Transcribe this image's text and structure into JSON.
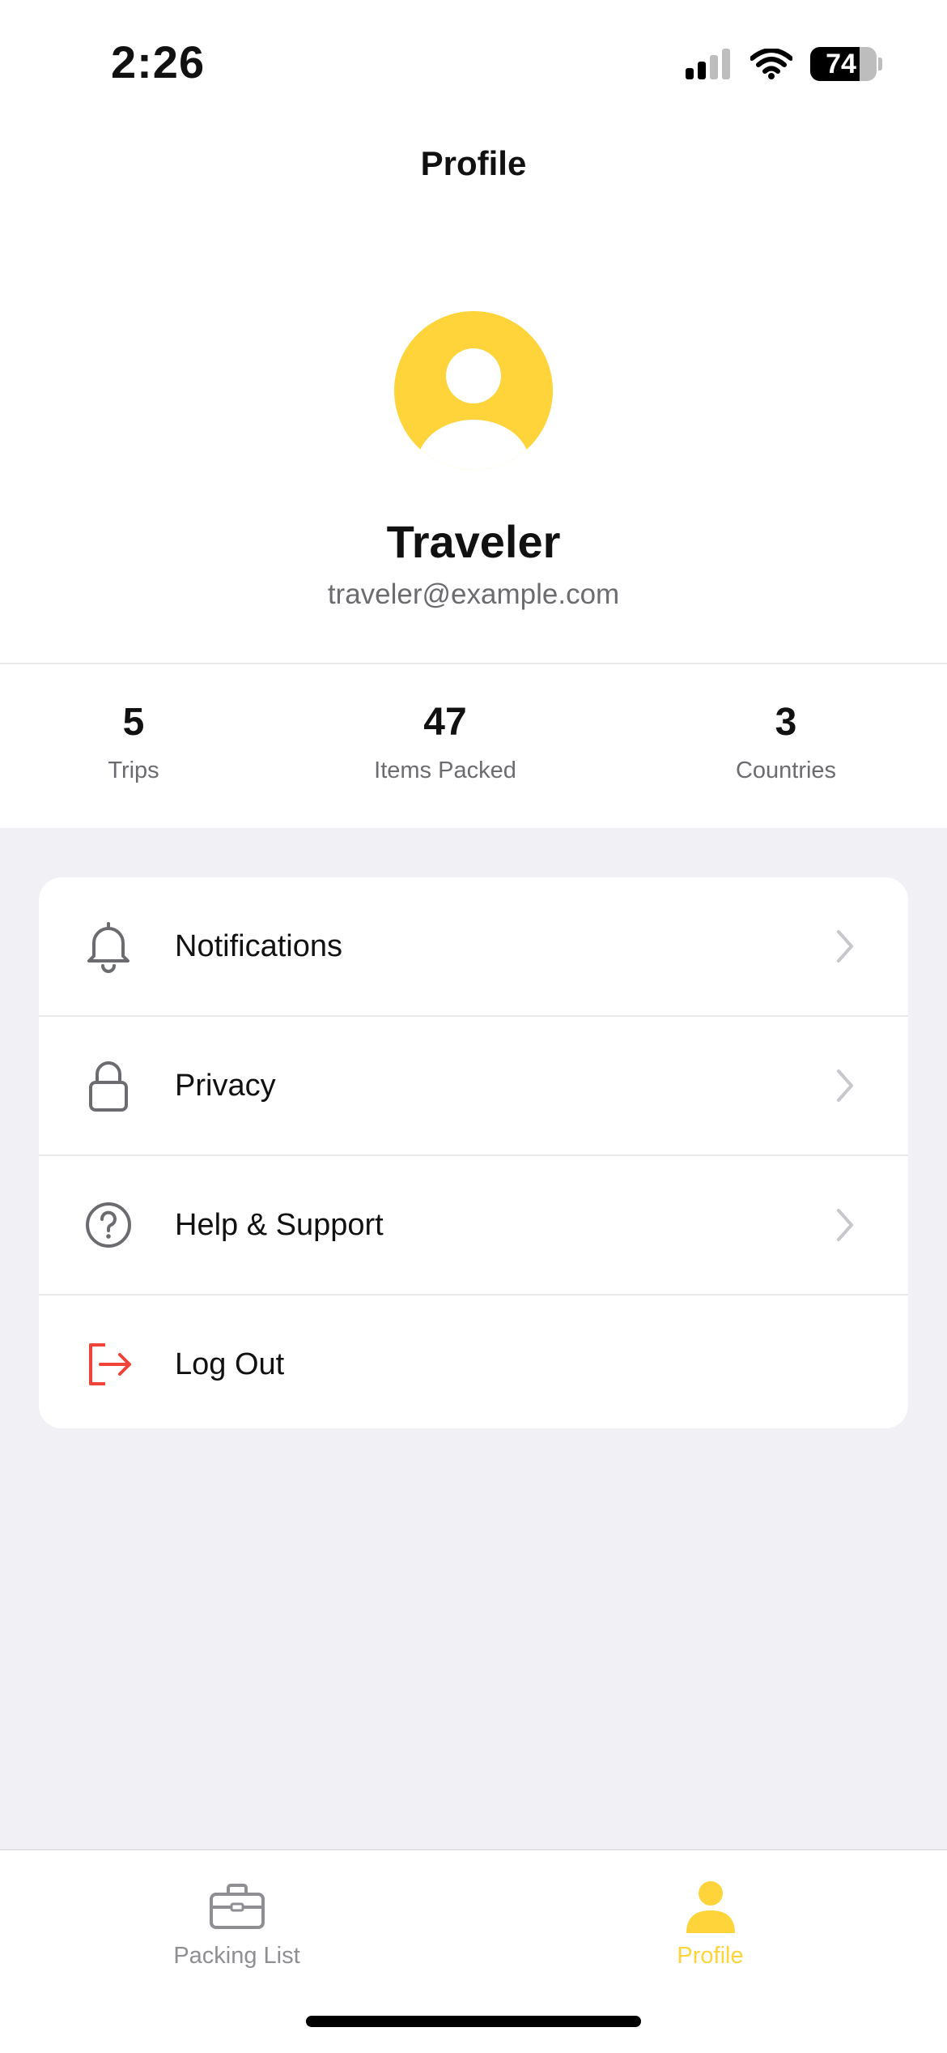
{
  "status_bar": {
    "time": "2:26",
    "battery_level": "74",
    "icons": [
      "signal-icon",
      "wifi-icon",
      "battery-icon"
    ]
  },
  "header": {
    "title": "Profile"
  },
  "profile": {
    "name": "Traveler",
    "email": "traveler@example.com",
    "avatar_icon": "user-avatar-icon",
    "avatar_color": "#FFD43B"
  },
  "stats": [
    {
      "value": "5",
      "label": "Trips"
    },
    {
      "value": "47",
      "label": "Items Packed"
    },
    {
      "value": "3",
      "label": "Countries"
    }
  ],
  "menu": [
    {
      "label": "Notifications",
      "icon": "bell-icon",
      "chevron": true
    },
    {
      "label": "Privacy",
      "icon": "lock-icon",
      "chevron": true
    },
    {
      "label": "Help & Support",
      "icon": "help-circle-icon",
      "chevron": true
    },
    {
      "label": "Log Out",
      "icon": "logout-icon",
      "chevron": false,
      "color": "#F04438"
    }
  ],
  "tabbar": {
    "tabs": [
      {
        "label": "Packing List",
        "icon": "briefcase-icon",
        "active": false
      },
      {
        "label": "Profile",
        "icon": "person-icon",
        "active": true
      }
    ],
    "active_color": "#FFD43B",
    "inactive_color": "#8E8E93"
  }
}
